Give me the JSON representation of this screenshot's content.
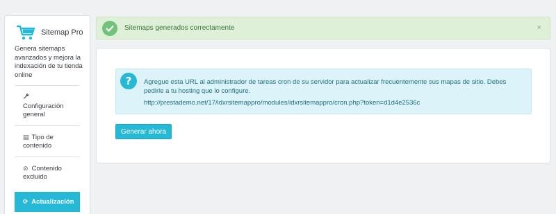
{
  "sidebar": {
    "title": "Sitemap Pro",
    "description": "Genera sitemaps avanzados y mejora la indexación de tu tienda online",
    "items": [
      {
        "icon": "wrench-icon",
        "glyph": "🔧",
        "label": "Configuración general"
      },
      {
        "icon": "list-icon",
        "glyph": "▤",
        "label": "Tipo de contenido"
      },
      {
        "icon": "ban-icon",
        "glyph": "⊘",
        "label": "Contenido excluido"
      },
      {
        "icon": "refresh-icon",
        "glyph": "⟳",
        "label": "Actualización",
        "active": true
      }
    ]
  },
  "success_alert": {
    "message": "Sitemaps generados correctamente",
    "close": "×"
  },
  "info_alert": {
    "icon": "question-icon",
    "icon_glyph": "?",
    "text": "Agregue esta URL al administrador de tareas cron de su servidor para actualizar frecuentemente sus mapas de sitio. Debes pedirle a tu hosting que lo configure.",
    "url": "http://prestademo.net/17/idxrsitemappro/modules/idxrsitemappro/cron.php?token=d1d4e2536c"
  },
  "buttons": {
    "generate": "Generar ahora"
  },
  "colors": {
    "accent": "#25b9d7",
    "success_bg": "#dff0d8",
    "success_text": "#3c763d",
    "info_bg": "#dcf4f9"
  }
}
